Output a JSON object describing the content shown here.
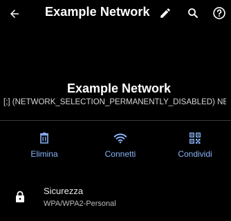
{
  "appbar": {
    "title": "Example Network",
    "back_icon": "arrow-back-icon",
    "edit_icon": "pencil-icon",
    "search_icon": "search-icon",
    "help_icon": "help-circle-icon"
  },
  "network": {
    "name": "Example Network",
    "status": "[;] (NETWORK_SELECTION_PERMANENTLY_DISABLED) NE.."
  },
  "actions": [
    {
      "label": "Elimina",
      "icon": "trash-icon"
    },
    {
      "label": "Connetti",
      "icon": "wifi-icon"
    },
    {
      "label": "Condividi",
      "icon": "qr-code-icon"
    }
  ],
  "security": {
    "title": "Sicurezza",
    "value": "WPA/WPA2-Personal",
    "icon": "lock-icon"
  },
  "colors": {
    "background": "#000000",
    "accent": "#8ab4f8",
    "text": "#ffffff",
    "secondary_text": "#bdbdbd"
  }
}
